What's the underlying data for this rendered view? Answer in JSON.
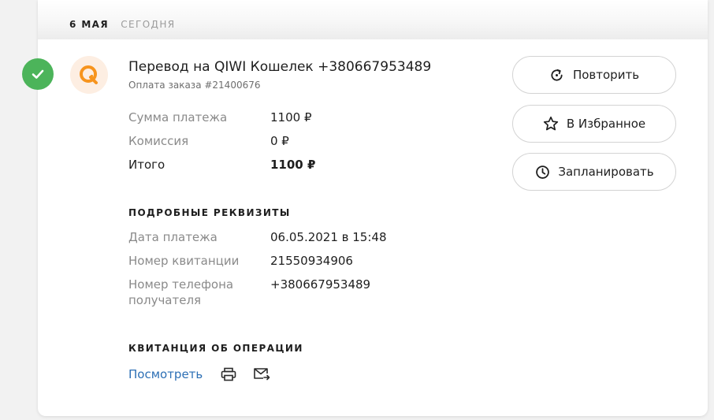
{
  "date_header": {
    "date": "6 мая",
    "relative": "сегодня"
  },
  "operation": {
    "title": "Перевод на QIWI Кошелек +380667953489",
    "subtitle": "Оплата заказа #21400676",
    "summary": [
      {
        "label": "Сумма платежа",
        "value": "1100 ₽"
      },
      {
        "label": "Комиссия",
        "value": "0 ₽"
      },
      {
        "label": "Итого",
        "value": "1100 ₽"
      }
    ]
  },
  "details": {
    "title": "Подробные реквизиты",
    "rows": [
      {
        "label": "Дата платежа",
        "value": "06.05.2021 в 15:48"
      },
      {
        "label": "Номер квитанции",
        "value": "21550934906"
      },
      {
        "label": "Номер телефона получателя",
        "value": "+380667953489"
      }
    ]
  },
  "receipt": {
    "title": "Квитанция об операции",
    "view_label": "Посмотреть"
  },
  "actions": {
    "repeat_label": "Повторить",
    "favorite_label": "В Избранное",
    "schedule_label": "Запланировать"
  },
  "colors": {
    "success": "#4cb45a",
    "qiwi_orange": "#f7941d",
    "link": "#2c6fb5"
  },
  "icons": {
    "status": "check-icon",
    "provider": "qiwi-logo-icon",
    "repeat": "refresh-icon",
    "favorite": "star-icon",
    "schedule": "clock-icon",
    "print": "printer-icon",
    "email": "mail-send-icon"
  }
}
